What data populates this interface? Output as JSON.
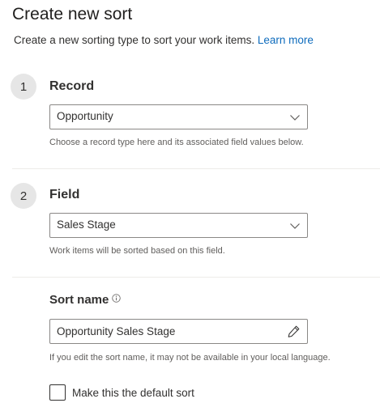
{
  "header": {
    "title": "Create new sort",
    "description": "Create a new sorting type to sort your work items.",
    "learn_more": "Learn more"
  },
  "steps": [
    {
      "number": "1",
      "title": "Record",
      "selected": "Opportunity",
      "help": "Choose a record type here and its associated field values below."
    },
    {
      "number": "2",
      "title": "Field",
      "selected": "Sales Stage",
      "help": "Work items will be sorted based on this field."
    }
  ],
  "sort_name": {
    "label": "Sort name",
    "value": "Opportunity Sales Stage",
    "help": "If you edit the sort name, it may not be available in your local language."
  },
  "default_sort": {
    "label": "Make this the default sort",
    "checked": false
  },
  "icons": {
    "dropdown": "chevron-down-icon",
    "edit": "pencil-icon",
    "info": "info-icon"
  },
  "colors": {
    "link": "#0f6cbd",
    "step_circle": "#e6e6e6"
  }
}
